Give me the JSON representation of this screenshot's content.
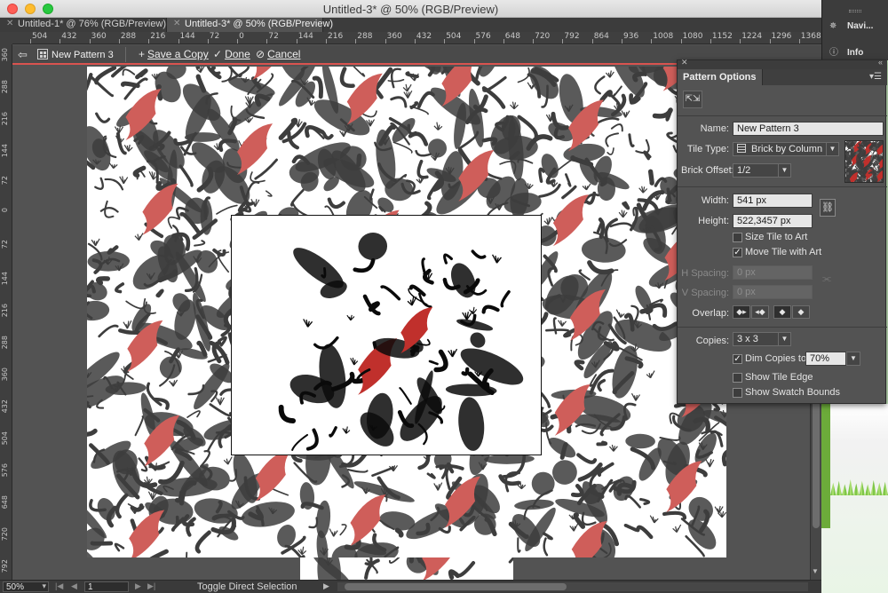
{
  "window": {
    "title": "Untitled-3* @ 50% (RGB/Preview)"
  },
  "doc_tabs": [
    {
      "label": "Untitled-1* @ 76% (RGB/Preview)",
      "active": false
    },
    {
      "label": "Untitled-3* @ 50% (RGB/Preview)",
      "active": true
    }
  ],
  "ruler": {
    "top_labels": [
      "504",
      "432",
      "360",
      "288",
      "216",
      "144",
      "72",
      "0",
      "72",
      "144",
      "216",
      "288",
      "360",
      "432",
      "504",
      "576",
      "648",
      "720",
      "792",
      "864",
      "936",
      "1008",
      "1080",
      "1152",
      "1224",
      "1296",
      "1368",
      "144"
    ],
    "left_labels": [
      "360",
      "288",
      "216",
      "144",
      "72",
      "0",
      "72",
      "144",
      "216",
      "288",
      "360",
      "432",
      "504",
      "576",
      "648",
      "720",
      "792",
      "864"
    ]
  },
  "pattern_bar": {
    "pattern_name": "New Pattern 3",
    "save_copy": "Save a Copy",
    "done": "Done",
    "cancel": "Cancel"
  },
  "dock": {
    "navigator": "Navi...",
    "info": "Info"
  },
  "status": {
    "zoom": "50%",
    "artboard": "1",
    "text": "Toggle Direct Selection"
  },
  "panel": {
    "tab": "Pattern Options",
    "name_label": "Name:",
    "name_value": "New Pattern 3",
    "tile_type_label": "Tile Type:",
    "tile_type_value": "Brick by Column",
    "brick_offset_label": "Brick Offset:",
    "brick_offset_value": "1/2",
    "width_label": "Width:",
    "width_value": "541 px",
    "height_label": "Height:",
    "height_value": "522,3457 px",
    "size_tile_to_art": "Size Tile to Art",
    "size_tile_to_art_checked": false,
    "move_tile_with_art": "Move Tile with Art",
    "move_tile_with_art_checked": true,
    "h_spacing_label": "H Spacing:",
    "h_spacing_value": "0 px",
    "v_spacing_label": "V Spacing:",
    "v_spacing_value": "0 px",
    "overlap_label": "Overlap:",
    "copies_label": "Copies:",
    "copies_value": "3 x 3",
    "dim_copies_label": "Dim Copies to:",
    "dim_copies_checked": true,
    "dim_copies_value": "70%",
    "show_tile_edge": "Show Tile Edge",
    "show_tile_edge_checked": false,
    "show_swatch_bounds": "Show Swatch Bounds",
    "show_swatch_bounds_checked": false
  },
  "colors": {
    "ink_dark": "#3d3d3d",
    "ink_black": "#0a0a0a",
    "ink_red": "#c0302c",
    "ink_red_dim": "#cf5e5a"
  }
}
